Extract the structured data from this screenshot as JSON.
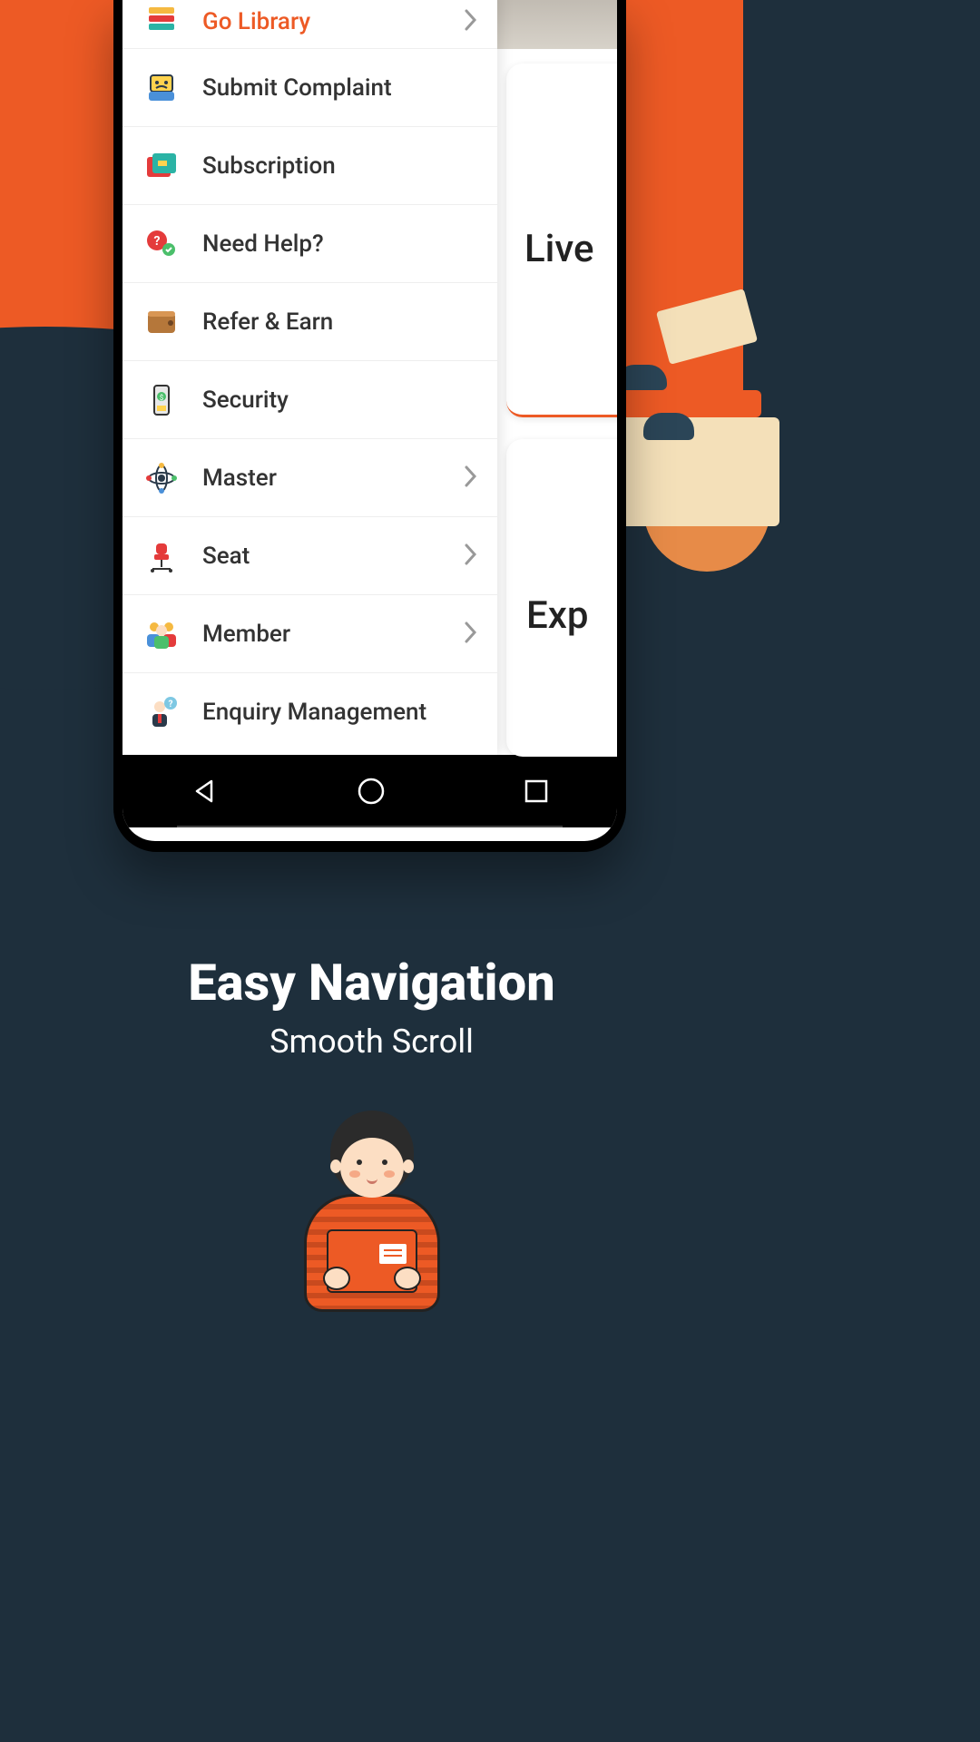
{
  "sidebar": {
    "items": [
      {
        "label": "Go Library",
        "chevron": true,
        "highlight": true
      },
      {
        "label": "Submit Complaint",
        "chevron": false,
        "highlight": false
      },
      {
        "label": "Subscription",
        "chevron": false,
        "highlight": false
      },
      {
        "label": "Need Help?",
        "chevron": false,
        "highlight": false
      },
      {
        "label": "Refer & Earn",
        "chevron": false,
        "highlight": false
      },
      {
        "label": "Security",
        "chevron": false,
        "highlight": false
      },
      {
        "label": "Master",
        "chevron": true,
        "highlight": false
      },
      {
        "label": "Seat",
        "chevron": true,
        "highlight": false
      },
      {
        "label": "Member",
        "chevron": true,
        "highlight": false
      },
      {
        "label": "Enquiry Management",
        "chevron": false,
        "highlight": false
      }
    ]
  },
  "content": {
    "card1": "Live",
    "card2": "Exp"
  },
  "promo": {
    "title": "Easy Navigation",
    "subtitle": "Smooth Scroll"
  },
  "colors": {
    "accent": "#ed5a25",
    "dark": "#1e2f3c"
  }
}
